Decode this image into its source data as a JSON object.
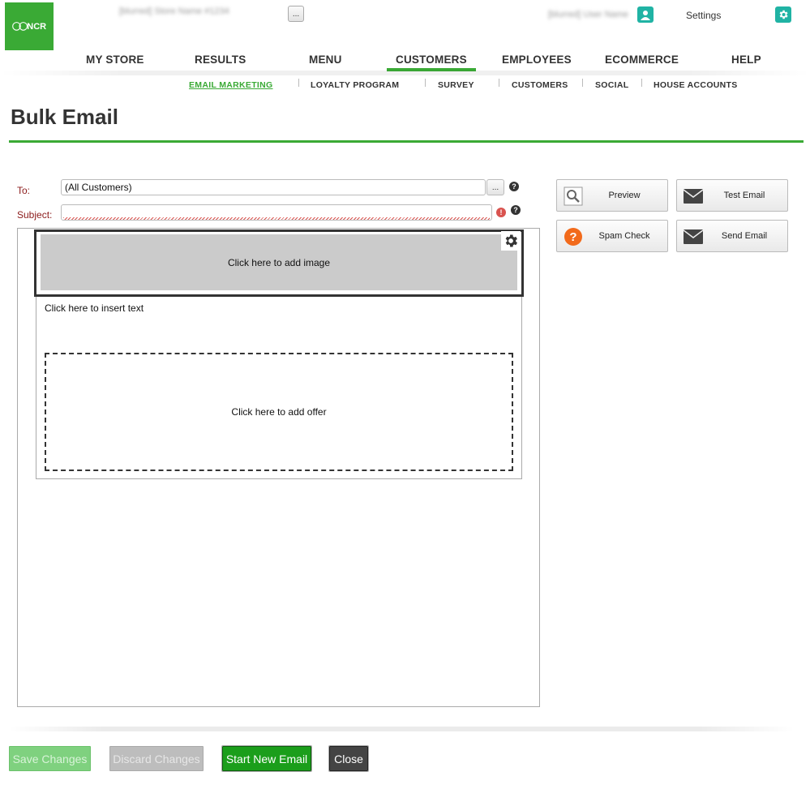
{
  "header": {
    "logo_text": "NCR",
    "store_name": "[blurred] Store Name #1234",
    "store_button_label": "...",
    "user_name": "[blurred] User Name",
    "settings_label": "Settings"
  },
  "main_nav": [
    {
      "label": "MY STORE"
    },
    {
      "label": "RESULTS"
    },
    {
      "label": "MENU"
    },
    {
      "label": "CUSTOMERS",
      "active": true
    },
    {
      "label": "EMPLOYEES"
    },
    {
      "label": "ECOMMERCE"
    },
    {
      "label": "HELP"
    }
  ],
  "sub_nav": [
    {
      "label": "EMAIL MARKETING",
      "active": true
    },
    {
      "label": "LOYALTY PROGRAM"
    },
    {
      "label": "SURVEY"
    },
    {
      "label": "CUSTOMERS"
    },
    {
      "label": "SOCIAL"
    },
    {
      "label": "HOUSE ACCOUNTS"
    }
  ],
  "page_title": "Bulk Email",
  "form": {
    "to_label": "To:",
    "to_value": "(All Customers)",
    "to_button_label": "...",
    "subject_label": "Subject:",
    "subject_value": ""
  },
  "editor": {
    "image_placeholder": "Click here to add image",
    "text_placeholder": "Click here to insert text",
    "offer_placeholder": "Click here to add offer"
  },
  "actions": {
    "preview": "Preview",
    "test_email": "Test Email",
    "spam_check": "Spam Check",
    "send_email": "Send Email"
  },
  "footer": {
    "save": "Save Changes",
    "discard": "Discard Changes",
    "start_new": "Start New Email",
    "close": "Close"
  },
  "colors": {
    "brand_green": "#3aaa35",
    "teal_icon": "#20b3a4",
    "spam_orange": "#f26a1b",
    "error_red": "#d9534f"
  }
}
